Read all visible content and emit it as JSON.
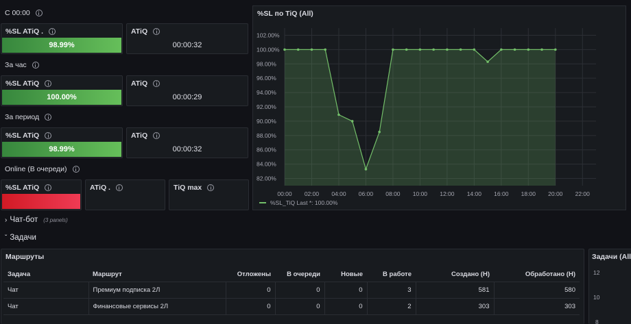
{
  "sections": {
    "s1": "С 00:00",
    "s2": "За час",
    "s3": "За период",
    "s4": "Online (В очереди)"
  },
  "stats": {
    "s1_sl_title": "%SL ATiQ .",
    "s1_sl_value": "98.99%",
    "s1_atiq_title": "ATiQ",
    "s1_atiq_value": "00:00:32",
    "s2_sl_title": "%SL ATiQ",
    "s2_sl_value": "100.00%",
    "s2_atiq_title": "ATiQ",
    "s2_atiq_value": "00:00:29",
    "s3_sl_title": "%SL ATiQ",
    "s3_sl_value": "98.99%",
    "s3_atiq_title": "ATiQ",
    "s3_atiq_value": "00:00:32",
    "s4_sl_title": "%SL ATiQ",
    "s4_atiq_title": "ATiQ .",
    "s4_tiqmax_title": "TiQ max"
  },
  "chart": {
    "title": "%SL по TiQ (All)",
    "legend_label": "%SL_TiQ",
    "legend_last": "Last *: 100.00%",
    "line_color": "#73bf69"
  },
  "chart_data": {
    "type": "area",
    "title": "%SL по TiQ (All)",
    "xlabel": "",
    "ylabel": "",
    "x_ticks": [
      "00:00",
      "02:00",
      "04:00",
      "06:00",
      "08:00",
      "10:00",
      "12:00",
      "14:00",
      "16:00",
      "18:00",
      "20:00",
      "22:00"
    ],
    "y_ticks": [
      "82.00%",
      "84.00%",
      "86.00%",
      "88.00%",
      "90.00%",
      "92.00%",
      "94.00%",
      "96.00%",
      "98.00%",
      "100.00%",
      "102.00%"
    ],
    "xlim": [
      0,
      23
    ],
    "ylim": [
      81,
      103
    ],
    "series": [
      {
        "name": "%SL_TiQ",
        "x": [
          0,
          1,
          2,
          3,
          4,
          5,
          6,
          7,
          8,
          9,
          10,
          11,
          12,
          13,
          14,
          15,
          16,
          17,
          18,
          19,
          20
        ],
        "values": [
          100,
          100,
          100,
          100,
          90.9,
          90.0,
          83.3,
          88.5,
          100,
          100,
          100,
          100,
          100,
          100,
          100,
          98.3,
          100,
          100,
          100,
          100,
          100
        ]
      }
    ],
    "grid": true,
    "legend": "bottom-left"
  },
  "rows": {
    "chatbot_label": "Чат-бот",
    "chatbot_note": "(3 panels)",
    "tasks_label": "Задачи"
  },
  "routes": {
    "title": "Маршруты",
    "headers": [
      "Задача",
      "Маршрут",
      "Отложены",
      "В очереди",
      "Новые",
      "В работе",
      "Создано (Н)",
      "Обработано (Н)"
    ],
    "rows": [
      [
        "Чат",
        "Премиум подписка 2Л",
        "0",
        "0",
        "0",
        "3",
        "581",
        "580"
      ],
      [
        "Чат",
        "Финансовые сервисы 2Л",
        "0",
        "0",
        "0",
        "2",
        "303",
        "303"
      ]
    ]
  },
  "side_panel": {
    "title": "Задачи (All)",
    "y_ticks": [
      "12",
      "10",
      "8"
    ]
  }
}
